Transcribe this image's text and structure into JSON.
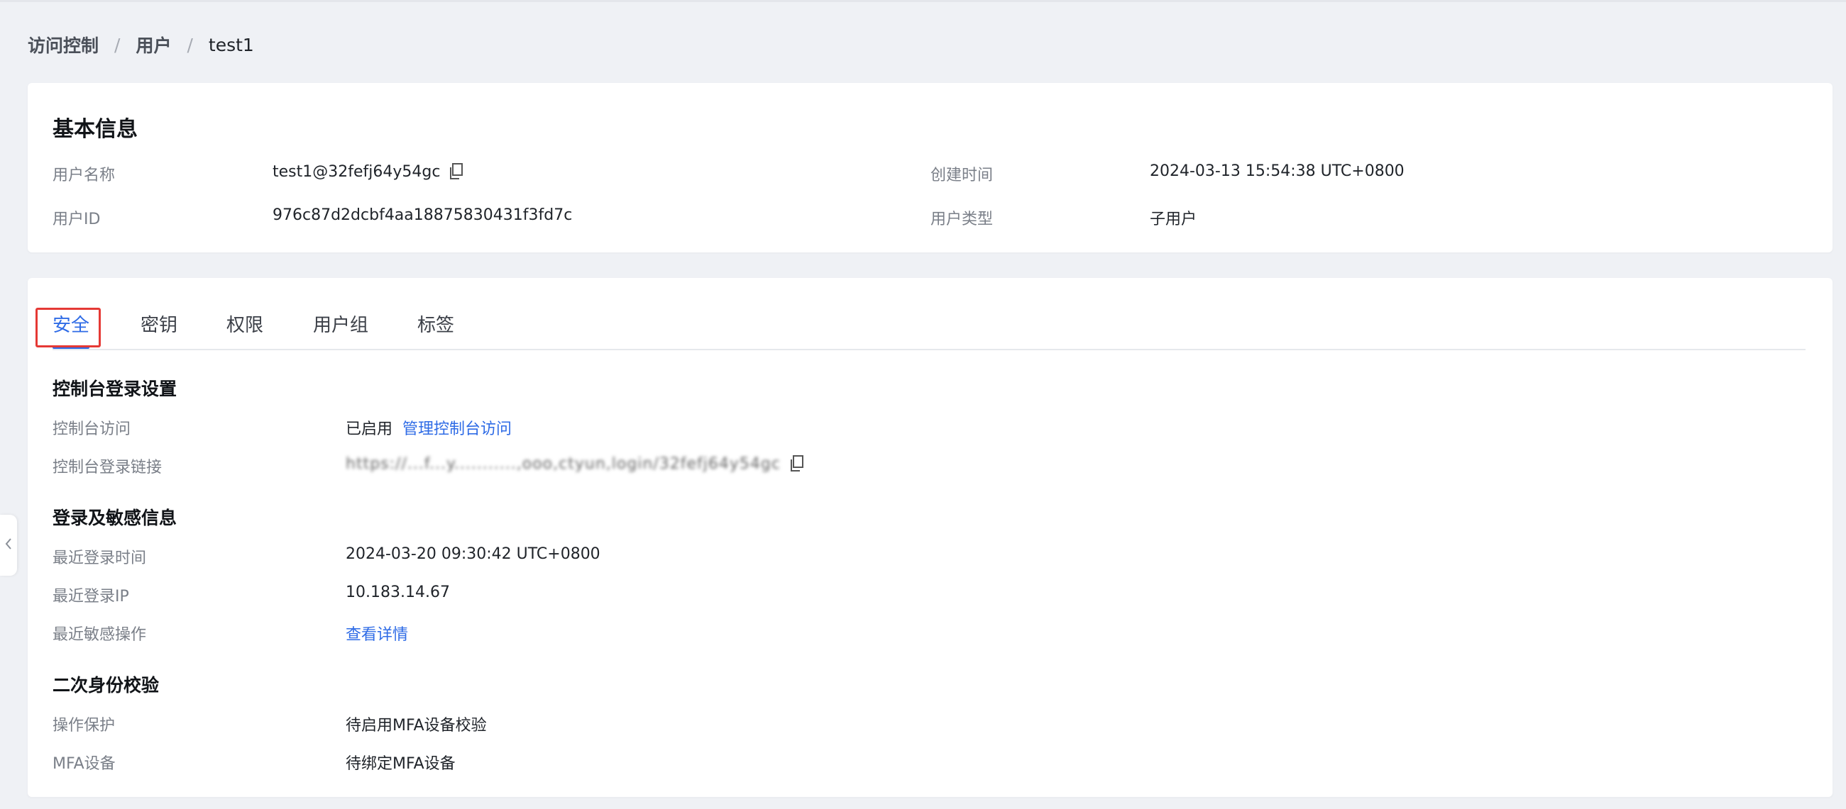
{
  "breadcrumb": {
    "items": [
      "访问控制",
      "用户",
      "test1"
    ],
    "separator": "/"
  },
  "basic_info": {
    "title": "基本信息",
    "user_name_label": "用户名称",
    "user_name_value": "test1@32fefj64y54gc",
    "user_id_label": "用户ID",
    "user_id_value": "976c87d2dcbf4aa18875830431f3fd7c",
    "created_label": "创建时间",
    "created_value": "2024-03-13 15:54:38 UTC+0800",
    "user_type_label": "用户类型",
    "user_type_value": "子用户"
  },
  "tabs": [
    {
      "label": "安全",
      "active": true
    },
    {
      "label": "密钥",
      "active": false
    },
    {
      "label": "权限",
      "active": false
    },
    {
      "label": "用户组",
      "active": false
    },
    {
      "label": "标签",
      "active": false
    }
  ],
  "console_login": {
    "title": "控制台登录设置",
    "access_label": "控制台访问",
    "access_status": "已启用",
    "manage_link": "管理控制台访问",
    "login_link_label": "控制台登录链接",
    "login_link_value": "https://...f...y...........,ooo,ctyun,login/32fefj64y54gc"
  },
  "login_sensitive": {
    "title": "登录及敏感信息",
    "last_login_time_label": "最近登录时间",
    "last_login_time_value": "2024-03-20 09:30:42 UTC+0800",
    "last_login_ip_label": "最近登录IP",
    "last_login_ip_value": "10.183.14.67",
    "last_sensitive_label": "最近敏感操作",
    "last_sensitive_link": "查看详情"
  },
  "second_auth": {
    "title": "二次身份校验",
    "op_protect_label": "操作保护",
    "op_protect_value": "待启用MFA设备校验",
    "mfa_label": "MFA设备",
    "mfa_value": "待绑定MFA设备"
  },
  "icons": {
    "copy": "copy-icon",
    "collapse": "chevron-left-icon"
  },
  "colors": {
    "accent": "#2e6be6",
    "highlight": "#e53935",
    "background": "#eff1f5"
  }
}
